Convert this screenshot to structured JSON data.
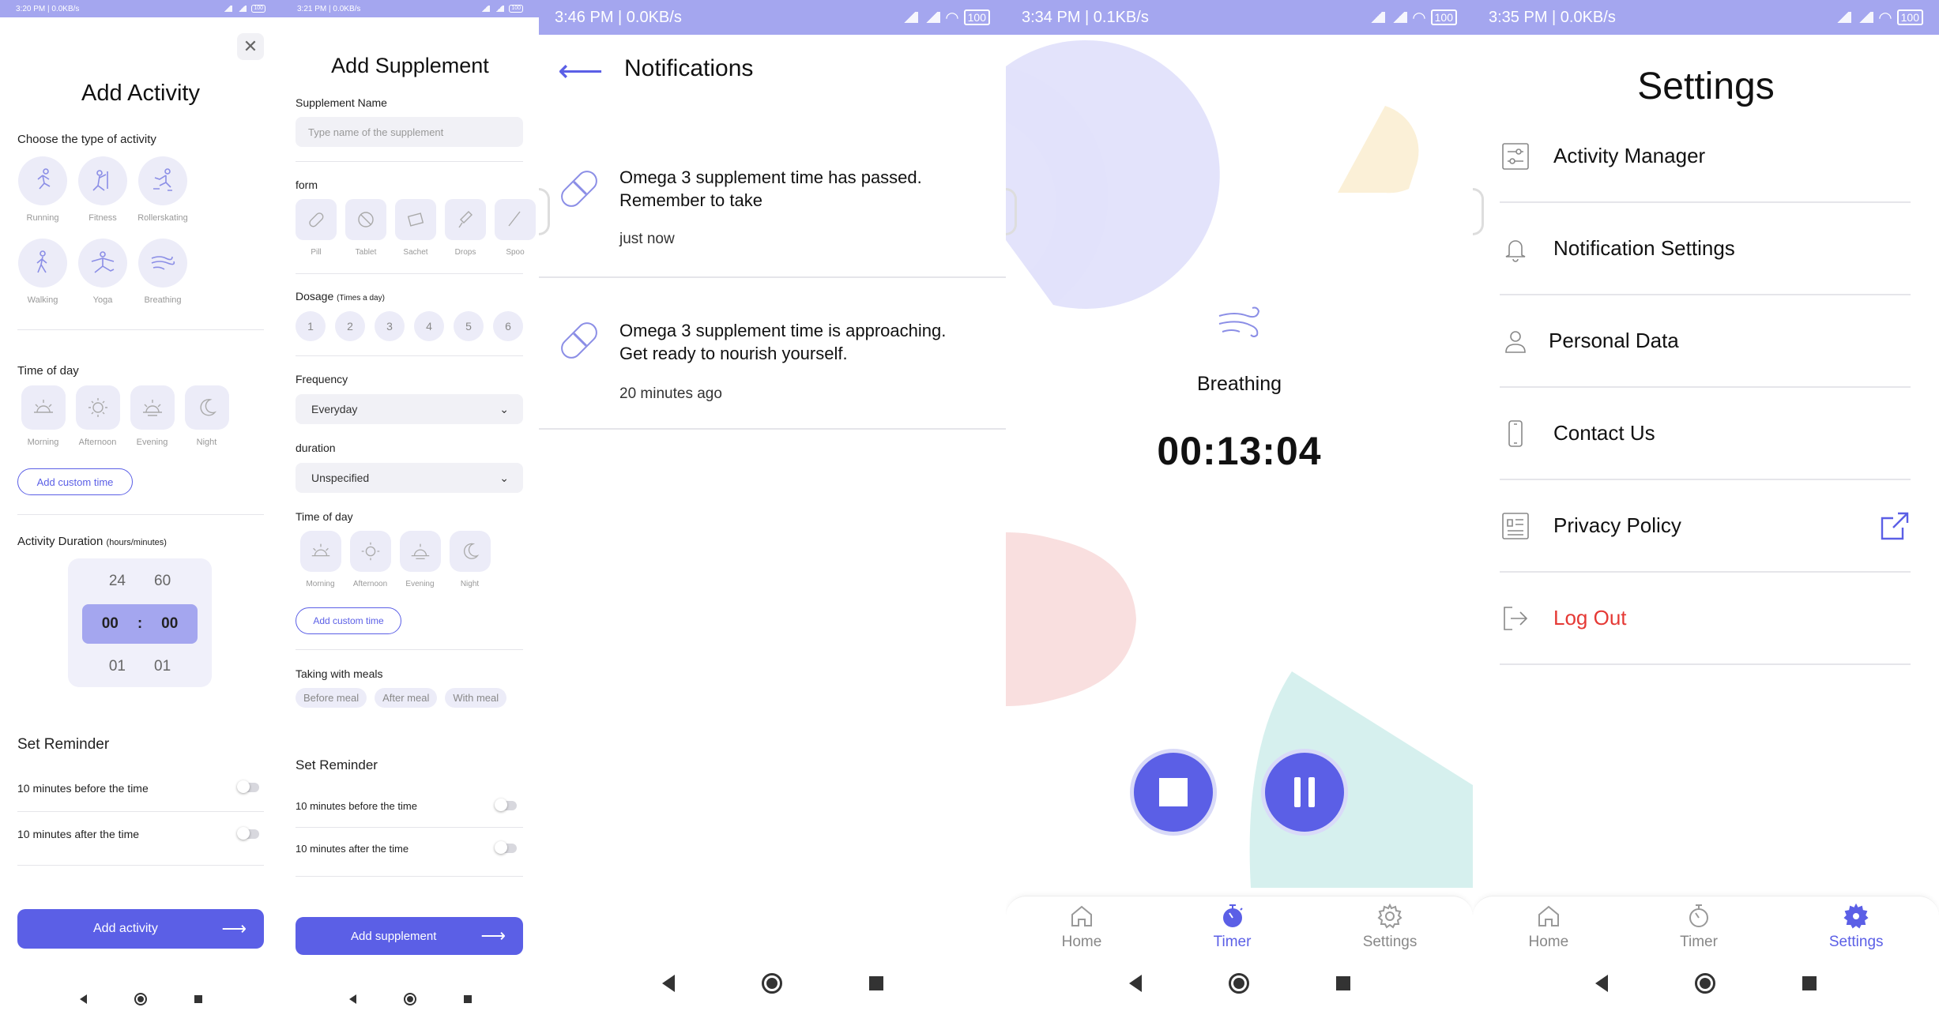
{
  "add_activity": {
    "status_time": "3:20 PM | 0.0KB/s",
    "battery": "100",
    "title": "Add Activity",
    "type_label": "Choose the type of activity",
    "activities": [
      {
        "label": "Running",
        "icon": "running-icon"
      },
      {
        "label": "Fitness",
        "icon": "fitness-icon"
      },
      {
        "label": "Rollerskating",
        "icon": "rollerskating-icon"
      },
      {
        "label": "Walking",
        "icon": "walking-icon"
      },
      {
        "label": "Yoga",
        "icon": "yoga-icon"
      },
      {
        "label": "Breathing",
        "icon": "breathing-icon"
      }
    ],
    "time_of_day_label": "Time of day",
    "times": [
      {
        "label": "Morning",
        "icon": "sunrise-icon"
      },
      {
        "label": "Afternoon",
        "icon": "sun-icon"
      },
      {
        "label": "Evening",
        "icon": "sunset-icon"
      },
      {
        "label": "Night",
        "icon": "moon-icon"
      }
    ],
    "custom_time_label": "Add custom time",
    "duration_label": "Activity Duration",
    "duration_unit": "(hours/minutes)",
    "duration_above": [
      "24",
      "60"
    ],
    "duration_selected": [
      "00",
      "00"
    ],
    "duration_below": [
      "01",
      "01"
    ],
    "duration_sep": ":",
    "reminder_label": "Set Reminder",
    "reminder_before": "10 minutes before the time",
    "reminder_after": "10 minutes after the time",
    "submit_label": "Add activity"
  },
  "add_supplement": {
    "status_time": "3:21 PM | 0.0KB/s",
    "battery": "100",
    "title": "Add Supplement",
    "name_label": "Supplement Name",
    "name_placeholder": "Type name of the supplement",
    "form_label": "form",
    "forms": [
      {
        "label": "Pill",
        "icon": "pill-icon"
      },
      {
        "label": "Tablet",
        "icon": "tablet-icon"
      },
      {
        "label": "Sachet",
        "icon": "sachet-icon"
      },
      {
        "label": "Drops",
        "icon": "drops-icon"
      },
      {
        "label": "Spoo",
        "icon": "spoon-icon"
      }
    ],
    "dosage_label": "Dosage",
    "dosage_unit": "(Times a day)",
    "dosage_options": [
      "1",
      "2",
      "3",
      "4",
      "5",
      "6"
    ],
    "frequency_label": "Frequency",
    "frequency_value": "Everyday",
    "duration_label": "duration",
    "duration_value": "Unspecified",
    "time_of_day_label": "Time of day",
    "times": [
      {
        "label": "Morning",
        "icon": "sunrise-icon"
      },
      {
        "label": "Afternoon",
        "icon": "sun-icon"
      },
      {
        "label": "Evening",
        "icon": "sunset-icon"
      },
      {
        "label": "Night",
        "icon": "moon-icon"
      }
    ],
    "custom_time_label": "Add custom time",
    "meals_label": "Taking with meals",
    "meals": [
      "Before meal",
      "After meal",
      "With meal"
    ],
    "reminder_label": "Set Reminder",
    "reminder_before": "10 minutes before the time",
    "reminder_after": "10 minutes after the time",
    "submit_label": "Add supplement"
  },
  "notifications": {
    "status_time": "3:46 PM | 0.0KB/s",
    "battery": "100",
    "title": "Notifications",
    "items": [
      {
        "message": "Omega 3 supplement time has passed. Remember to take",
        "time": "just now"
      },
      {
        "message": "Omega 3 supplement time is approaching. Get ready to nourish yourself.",
        "time": "20 minutes ago"
      }
    ]
  },
  "timer": {
    "status_time": "3:34 PM | 0.1KB/s",
    "battery": "100",
    "activity": "Breathing",
    "elapsed": "00:13:04",
    "colors": {
      "accent": "#5b5fe6",
      "lavender": "#dcdcfa",
      "peach": "#fbefd6",
      "pink": "#f9dede",
      "mint": "#d6f0ee"
    }
  },
  "settings": {
    "status_time": "3:35 PM | 0.0KB/s",
    "battery": "100",
    "title": "Settings",
    "items": [
      {
        "label": "Activity Manager",
        "icon": "sliders-icon"
      },
      {
        "label": "Notification Settings",
        "icon": "bell-icon"
      },
      {
        "label": "Personal Data",
        "icon": "user-icon"
      },
      {
        "label": "Contact Us",
        "icon": "phone-icon"
      },
      {
        "label": "Privacy Policy",
        "icon": "document-icon"
      },
      {
        "label": "Log Out",
        "icon": "logout-icon"
      }
    ],
    "logout_color": "#e53935"
  },
  "tabs": {
    "home": "Home",
    "timer": "Timer",
    "settings": "Settings"
  }
}
